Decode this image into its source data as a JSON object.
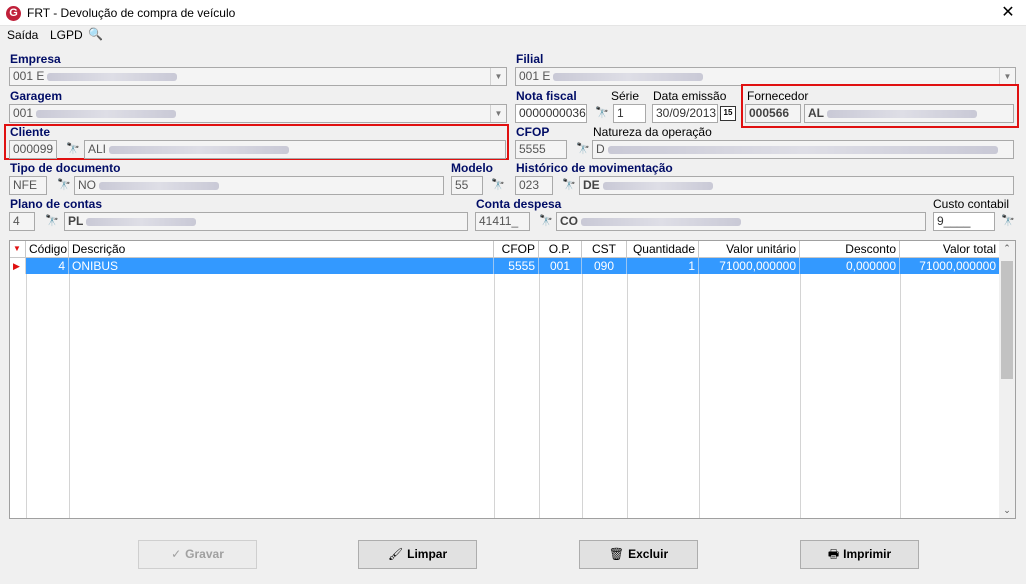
{
  "window": {
    "title": "FRT - Devolução de compra de veículo",
    "app_icon_glyph": "G",
    "close_glyph": "✕"
  },
  "menu": {
    "saida": "Saída",
    "lgpd": "LGPD",
    "search_glyph": "🔍"
  },
  "empresa": {
    "label": "Empresa",
    "value": "001 E"
  },
  "filial": {
    "label": "Filial",
    "value": "001 E"
  },
  "garagem": {
    "label": "Garagem",
    "value": "001"
  },
  "nota_fiscal": {
    "label": "Nota fiscal",
    "value": "0000000036"
  },
  "serie": {
    "label": "Série",
    "value": "1"
  },
  "data_emissao": {
    "label": "Data emissão",
    "value": "30/09/2013",
    "cal_glyph": "15"
  },
  "fornecedor": {
    "label": "Fornecedor",
    "code": "000566",
    "name": "AL"
  },
  "cliente": {
    "label": "Cliente",
    "code": "000099",
    "name": "ALI"
  },
  "cfop": {
    "label": "CFOP",
    "value": "5555"
  },
  "natureza": {
    "label": "Natureza da operação",
    "value": "D"
  },
  "tipo_documento": {
    "label": "Tipo de documento",
    "code": "NFE",
    "name": "NO"
  },
  "modelo": {
    "label": "Modelo",
    "value": "55"
  },
  "historico": {
    "label": "Histórico de movimentação",
    "code": "023",
    "name": "DE"
  },
  "plano_contas": {
    "label": "Plano de contas",
    "code": "4",
    "name": "PL"
  },
  "conta_despesa": {
    "label": "Conta despesa",
    "code": "41411_",
    "name": "CO"
  },
  "custo_contabil": {
    "label": "Custo contabil",
    "value": "9____"
  },
  "binoculars_glyph": "🔭",
  "grid": {
    "headers": [
      "Código",
      "Descrição",
      "CFOP",
      "O.P.",
      "CST",
      "Quantidade",
      "Valor unitário",
      "Desconto",
      "Valor total"
    ],
    "rows": [
      [
        "4",
        "ONIBUS",
        "5555",
        "001",
        "090",
        "1",
        "71000,000000",
        "0,000000",
        "71000,000000"
      ]
    ],
    "sort_glyph": "▼",
    "row_pointer_glyph": "▶"
  },
  "buttons": {
    "gravar": {
      "label": "Gravar",
      "icon": "✓"
    },
    "limpar": {
      "label": "Limpar",
      "icon": "🖌"
    },
    "excluir": {
      "label": "Excluir",
      "icon": "🗑"
    },
    "imprimir": {
      "label": "Imprimir",
      "icon": "🖶"
    }
  },
  "colors": {
    "accent_label": "#000c66",
    "selection": "#3399ff",
    "highlight_box": "#e01010"
  }
}
